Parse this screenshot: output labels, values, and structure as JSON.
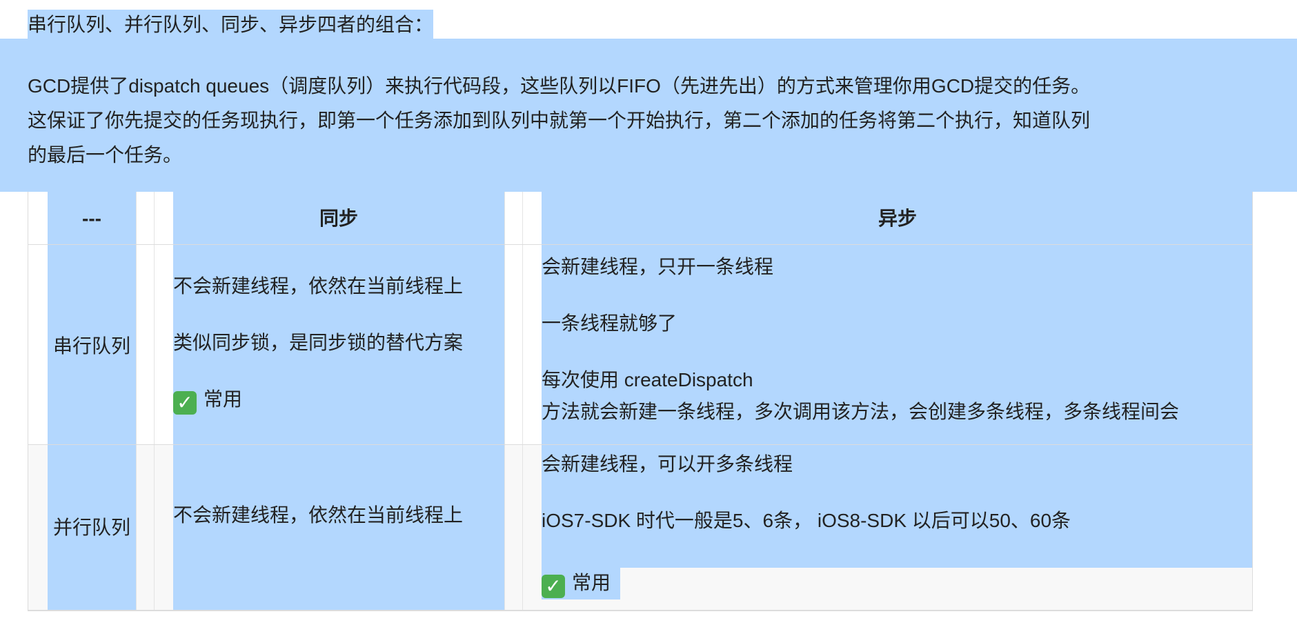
{
  "heading": "串行队列、并行队列、同步、异步四者的组合：",
  "paragraph_lines": [
    "GCD提供了dispatch queues（调度队列）来执行代码段，这些队列以FIFO（先进先出）的方式来管理你用GCD提交的任务。",
    "这保证了你先提交的任务现执行，即第一个任务添加到队列中就第一个开始执行，第二个添加的任务将第二个执行，知道队列",
    "的最后一个任务。"
  ],
  "table": {
    "headers": [
      "---",
      "同步",
      "异步"
    ],
    "rows": [
      {
        "label": "串行队列",
        "sync": [
          "不会新建线程，依然在当前线程上",
          "类似同步锁，是同步锁的替代方案",
          "常用"
        ],
        "async": [
          "会新建线程，只开一条线程",
          "一条线程就够了",
          "每次使用 createDispatch",
          "方法就会新建一条线程，多次调用该方法，会创建多条线程，多条线程间会"
        ]
      },
      {
        "label": "并行队列",
        "sync": [
          "不会新建线程，依然在当前线程上"
        ],
        "async": [
          "会新建线程，可以开多条线程",
          "iOS7-SDK 时代一般是5、6条， iOS8-SDK 以后可以50、60条",
          "常用"
        ]
      }
    ]
  },
  "icons": {
    "check": "check-mark-button-icon"
  },
  "colors": {
    "selection": "#b3d7fe",
    "check_green": "#4caf50"
  }
}
